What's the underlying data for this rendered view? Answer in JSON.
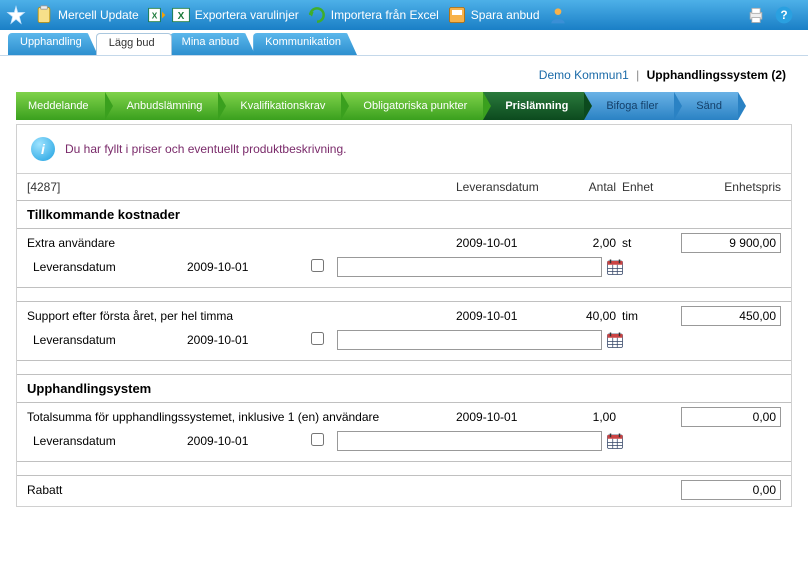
{
  "toolbar": {
    "mercell_update": "Mercell Update",
    "exportera": "Exportera varulinjer",
    "importera": "Importera från Excel",
    "spara": "Spara anbud"
  },
  "tabs": {
    "upphandling": "Upphandling",
    "lagg_bud": "Lägg bud",
    "mina_anbud": "Mina anbud",
    "kommunikation": "Kommunikation"
  },
  "context": {
    "org": "Demo Kommun1",
    "sep": "|",
    "system": "Upphandlingssystem (2)"
  },
  "wizard": {
    "meddelande": "Meddelande",
    "anbudslamning": "Anbudslämning",
    "kvalifikationskrav": "Kvalifikationskrav",
    "obligatoriska": "Obligatoriska punkter",
    "prislamning": "Prislämning",
    "bifoga": "Bifoga filer",
    "sand": "Sänd"
  },
  "info": {
    "text": "Du har fyllt i priser och eventuellt produktbeskrivning."
  },
  "sheet_header": {
    "id": "[4287]",
    "leveransdatum": "Leveransdatum",
    "antal": "Antal",
    "enhet": "Enhet",
    "enhetspris": "Enhetspris"
  },
  "sections": {
    "tillkommande": "Tillkommande kostnader",
    "upphandlingsystem": "Upphandlingsystem"
  },
  "labels": {
    "leveransdatum": "Leveransdatum"
  },
  "items": {
    "extra_anvandare": {
      "name": "Extra användare",
      "date": "2009-10-01",
      "qty": "2,00",
      "unit": "st",
      "price": "9 900,00",
      "deliv_date": "2009-10-01"
    },
    "support": {
      "name": "Support efter första året, per hel timma",
      "date": "2009-10-01",
      "qty": "40,00",
      "unit": "tim",
      "price": "450,00",
      "deliv_date": "2009-10-01"
    },
    "totalsumma": {
      "name": "Totalsumma för upphandlingssystemet, inklusive 1 (en) användare",
      "date": "2009-10-01",
      "qty": "1,00",
      "unit": "",
      "price": "0,00",
      "deliv_date": "2009-10-01"
    },
    "rabatt": {
      "name": "Rabatt",
      "price": "0,00"
    }
  }
}
